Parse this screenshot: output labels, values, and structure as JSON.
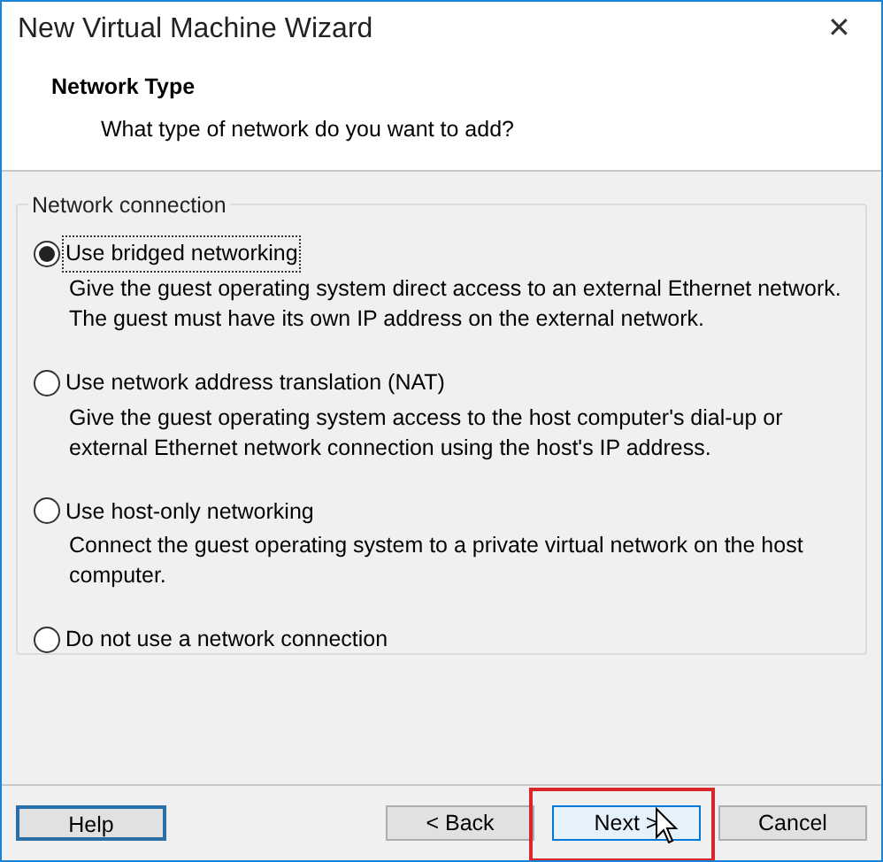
{
  "window": {
    "title": "New Virtual Machine Wizard",
    "close": "✕"
  },
  "header": {
    "title": "Network Type",
    "subtitle": "What type of network do you want to add?"
  },
  "group": {
    "label": "Network connection",
    "options": [
      {
        "label": "Use bridged networking",
        "description": "Give the guest operating system direct access to an external Ethernet network. The guest must have its own IP address on the external network.",
        "selected": true
      },
      {
        "label": "Use network address translation (NAT)",
        "description": "Give the guest operating system access to the host computer's dial-up or external Ethernet network connection using the host's IP address.",
        "selected": false
      },
      {
        "label": "Use host-only networking",
        "description": "Connect the guest operating system to a private virtual network on the host computer.",
        "selected": false
      },
      {
        "label": "Do not use a network connection",
        "selected": false
      }
    ]
  },
  "buttons": [
    {
      "label": "Help",
      "kind": "help",
      "focused": true,
      "highlighted": false
    },
    {
      "label": "< Back",
      "kind": "nav",
      "focused": false,
      "highlighted": false
    },
    {
      "label": "Next >",
      "kind": "nav",
      "focused": false,
      "highlighted": true
    },
    {
      "label": "Cancel",
      "kind": "nav",
      "focused": false,
      "highlighted": false
    }
  ]
}
